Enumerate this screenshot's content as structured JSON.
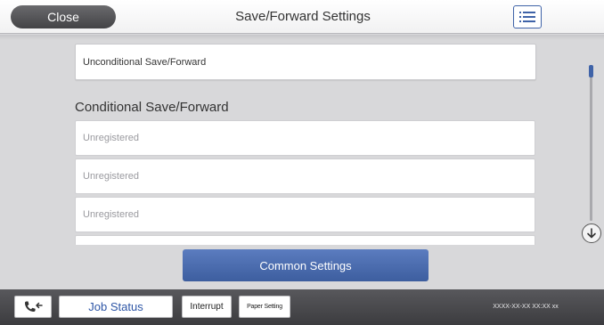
{
  "header": {
    "close_label": "Close",
    "title": "Save/Forward Settings",
    "menu_icon": "list-icon"
  },
  "main": {
    "unconditional_label": "Unconditional Save/Forward",
    "conditional_heading": "Conditional Save/Forward",
    "conditional_items": [
      {
        "label": "Unregistered"
      },
      {
        "label": "Unregistered"
      },
      {
        "label": "Unregistered"
      },
      {
        "label": ""
      }
    ],
    "common_settings_label": "Common Settings",
    "scroll_down_icon": "arrow-down-circle-icon"
  },
  "status_bar": {
    "fax_icon": "fax-phone-icon",
    "job_status_label": "Job Status",
    "interrupt_label": "Interrupt",
    "paper_setting_label": "Paper Setting",
    "datetime": "XXXX-XX-XX XX:XX xx"
  },
  "colors": {
    "accent": "#3f63a8",
    "background": "#d8d8da",
    "status_bar": "#464649",
    "close_button": "#555558"
  }
}
